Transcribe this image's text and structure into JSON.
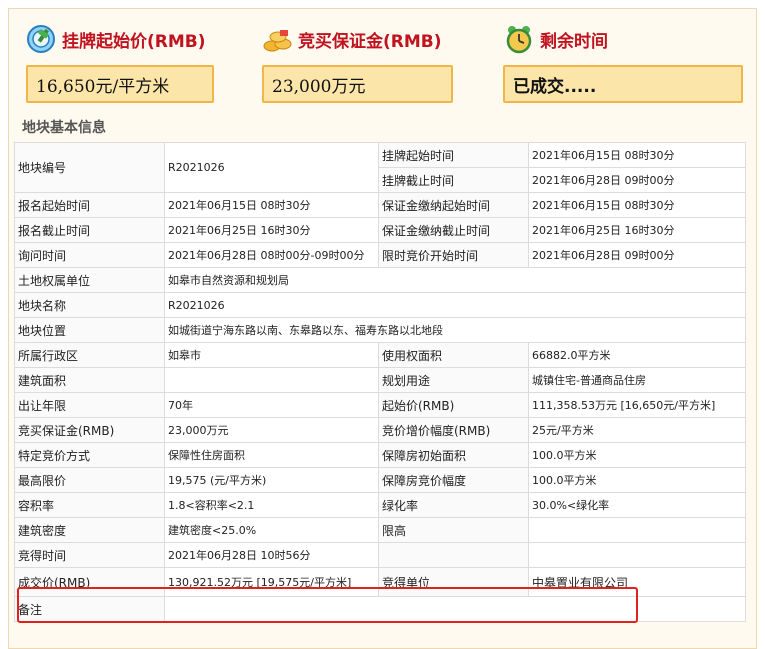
{
  "summary": {
    "start_price": {
      "label": "挂牌起始价(RMB)",
      "value": "16,650元/平方米",
      "icon": "auction-gavel-icon"
    },
    "deposit": {
      "label": "竞买保证金(RMB)",
      "value": "23,000万元",
      "icon": "coins-icon"
    },
    "remaining": {
      "label": "剩余时间",
      "value": "已成交.....",
      "icon": "alarm-clock-icon"
    }
  },
  "section_title": "地块基本信息",
  "rows": [
    {
      "k1": "地块编号",
      "v1": "R2021026",
      "k2": "挂牌起始时间",
      "v2": "2021年06月15日 08时30分"
    },
    {
      "k1": "",
      "v1": "",
      "k2": "挂牌截止时间",
      "v2": "2021年06月28日 09时00分"
    },
    {
      "k1": "报名起始时间",
      "v1": "2021年06月15日 08时30分",
      "k2": "保证金缴纳起始时间",
      "v2": "2021年06月15日 08时30分"
    },
    {
      "k1": "报名截止时间",
      "v1": "2021年06月25日 16时30分",
      "k2": "保证金缴纳截止时间",
      "v2": "2021年06月25日 16时30分"
    },
    {
      "k1": "询问时间",
      "v1": "2021年06月28日 08时00分-09时00分",
      "k2": "限时竞价开始时间",
      "v2": "2021年06月28日 09时00分"
    },
    {
      "k1": "土地权属单位",
      "v1": "如皋市自然资源和规划局"
    },
    {
      "k1": "地块名称",
      "v1": "R2021026"
    },
    {
      "k1": "地块位置",
      "v1": "如城街道宁海东路以南、东皋路以东、福寿东路以北地段"
    },
    {
      "k1": "所属行政区",
      "v1": "如皋市",
      "k2": "使用权面积",
      "v2": "66882.0平方米"
    },
    {
      "k1": "建筑面积",
      "v1": "",
      "k2": "规划用途",
      "v2": "城镇住宅-普通商品住房"
    },
    {
      "k1": "出让年限",
      "v1": "70年",
      "k2": "起始价(RMB)",
      "v2": "111,358.53万元 [16,650元/平方米]"
    },
    {
      "k1": "竞买保证金(RMB)",
      "v1": "23,000万元",
      "k2": "竞价增价幅度(RMB)",
      "v2": "25元/平方米"
    },
    {
      "k1": "特定竞价方式",
      "v1": "保障性住房面积",
      "k2": "保障房初始面积",
      "v2": "100.0平方米"
    },
    {
      "k1": "最高限价",
      "v1": "19,575 (元/平方米)",
      "k2": "保障房竞价幅度",
      "v2": "100.0平方米"
    },
    {
      "k1": "容积率",
      "v1": "1.8<容积率<2.1",
      "k2": "绿化率",
      "v2": "30.0%<绿化率"
    },
    {
      "k1": "建筑密度",
      "v1": "建筑密度<25.0%",
      "k2": "限高",
      "v2": ""
    },
    {
      "k1": "竞得时间",
      "v1": "2021年06月28日 10时56分",
      "k2": "",
      "v2": ""
    },
    {
      "k1": "成交价(RMB)",
      "v1": "130,921.52万元 [19,575元/平方米]",
      "k2": "竞得单位",
      "v2": "中皋置业有限公司"
    },
    {
      "k1": "备注",
      "v1": ""
    }
  ],
  "colors": {
    "accent_red": "#c0121f",
    "box_fill": "#fbe5a8",
    "box_border": "#f0b64a",
    "highlight": "#e0221c"
  }
}
